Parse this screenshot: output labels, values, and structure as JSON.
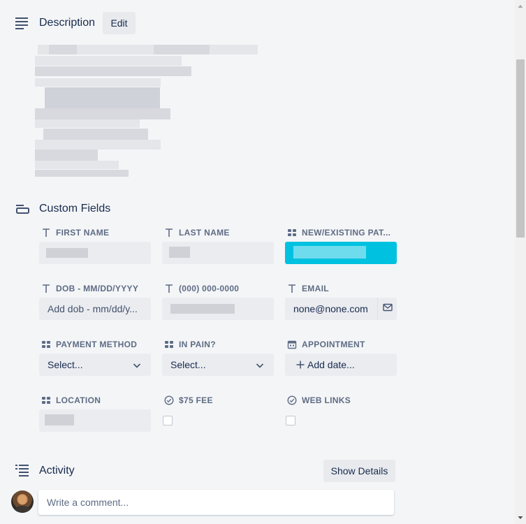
{
  "description": {
    "title": "Description",
    "edit_label": "Edit"
  },
  "custom_fields": {
    "title": "Custom Fields",
    "fields": {
      "first_name": {
        "label": "FIRST NAME"
      },
      "last_name": {
        "label": "LAST NAME"
      },
      "new_existing": {
        "label": "NEW/EXISTING PAT...",
        "accent": "#00c2e0"
      },
      "dob": {
        "label": "DOB - MM/DD/YYYY",
        "placeholder": "Add dob - mm/dd/y..."
      },
      "phone": {
        "label": "(000) 000-0000"
      },
      "email": {
        "label": "EMAIL",
        "value": "none@none.com"
      },
      "payment_method": {
        "label": "PAYMENT METHOD",
        "value": "Select..."
      },
      "in_pain": {
        "label": "IN PAIN?",
        "value": "Select..."
      },
      "appointment": {
        "label": "APPOINTMENT",
        "value": "Add date..."
      },
      "location": {
        "label": "LOCATION"
      },
      "fee": {
        "label": "$75 FEE"
      },
      "web_links": {
        "label": "WEB LINKS"
      }
    }
  },
  "activity": {
    "title": "Activity",
    "show_details_label": "Show Details",
    "comment_placeholder": "Write a comment..."
  },
  "icons": {
    "description": "align-left-icon",
    "custom_fields": "card-field-icon",
    "text_field": "text-t-icon",
    "dropdown_field": "dropdown-grid-icon",
    "date_field": "calendar-icon",
    "checkbox_field": "check-circle-icon",
    "activity": "list-icon",
    "email_action": "envelope-icon",
    "select_chevron": "chevron-down-icon"
  }
}
